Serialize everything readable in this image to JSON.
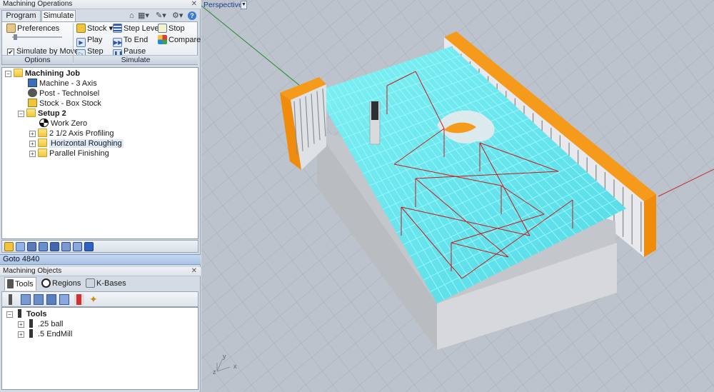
{
  "panel_operations": {
    "title": "Machining Operations"
  },
  "tabs": [
    {
      "label": "Program"
    },
    {
      "label": "Simulate"
    }
  ],
  "ribbon": {
    "options": {
      "preferences": "Preferences",
      "simulate_by_moves": "Simulate by Moves",
      "simulate_by_moves_checked": true,
      "group_label": "Options"
    },
    "simulate": {
      "stock": "Stock",
      "play": "Play",
      "step": "Step",
      "step_levels": "Step Levels",
      "to_end": "To End",
      "pause": "Pause",
      "stop": "Stop",
      "compare": "Compare",
      "group_label": "Simulate"
    }
  },
  "ops_tree": {
    "root": "Machining Job",
    "machine": "Machine - 3 Axis",
    "post": "Post - TechnoIsel",
    "stock": "Stock - Box Stock",
    "setup": "Setup 2",
    "work_zero": "Work Zero",
    "ops": [
      "2 1/2 Axis Profiling",
      "Horizontal Roughing",
      "Parallel Finishing"
    ]
  },
  "status": {
    "goto": "Goto 4840"
  },
  "panel_objects": {
    "title": "Machining Objects"
  },
  "object_tabs": [
    {
      "label": "Tools"
    },
    {
      "label": "Regions"
    },
    {
      "label": "K-Bases"
    }
  ],
  "tools_tree": {
    "root": "Tools",
    "items": [
      ".25 ball",
      ".5 EndMill"
    ]
  },
  "viewport": {
    "label": "Perspective",
    "axis_y": "y",
    "axis_x": "x",
    "axis_z": "z"
  },
  "colors": {
    "toolpath": "#4fdde8",
    "rapid": "#d01818",
    "stock": "#f28e0c",
    "part": "#cfd2d6",
    "accent": "#3a7bd5"
  }
}
